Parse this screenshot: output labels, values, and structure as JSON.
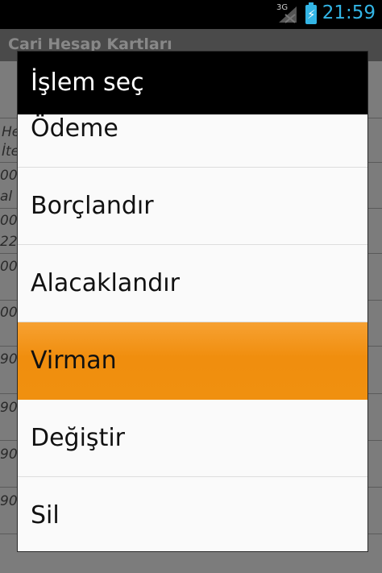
{
  "status_bar": {
    "network": "3G",
    "time": "21:59",
    "battery_icon": "battery-charging-icon"
  },
  "background_app": {
    "title": "Cari Hesap Kartları",
    "cells": [
      "He",
      "İte",
      "00",
      "al",
      "00",
      "22",
      "00",
      "00",
      "90",
      "90",
      "90",
      "90"
    ]
  },
  "dialog": {
    "title": "İşlem seç",
    "items": [
      {
        "label": "Ödeme"
      },
      {
        "label": "Borçlandır"
      },
      {
        "label": "Alacaklandır"
      },
      {
        "label": "Virman",
        "selected": true
      },
      {
        "label": "Değiştir"
      },
      {
        "label": "Sil"
      }
    ]
  },
  "colors": {
    "highlight": "#f0900f",
    "status_accent": "#33b5e5"
  }
}
